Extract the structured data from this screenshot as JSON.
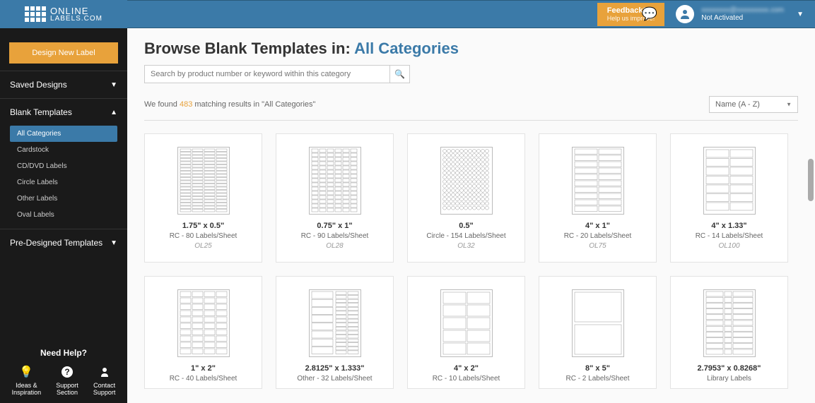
{
  "header": {
    "logo_line1": "ONLINE",
    "logo_line2": "LABELS.COM",
    "feedback_title": "Feedback?",
    "feedback_sub": "Help us improve!",
    "user_email": "xxxxxxxx@xxxxxxxxx.com",
    "user_status": "Not Activated"
  },
  "sidebar": {
    "design_btn": "Design New Label",
    "sections": [
      {
        "title": "Saved Designs",
        "expanded": false
      },
      {
        "title": "Blank Templates",
        "expanded": true,
        "items": [
          {
            "label": "All Categories",
            "active": true
          },
          {
            "label": "Cardstock"
          },
          {
            "label": "CD/DVD Labels"
          },
          {
            "label": "Circle Labels"
          },
          {
            "label": "Other Labels"
          },
          {
            "label": "Oval Labels"
          }
        ]
      },
      {
        "title": "Pre-Designed Templates",
        "expanded": false
      }
    ],
    "help_title": "Need Help?",
    "help_items": [
      {
        "label1": "Ideas &",
        "label2": "Inspiration"
      },
      {
        "label1": "Support",
        "label2": "Section"
      },
      {
        "label1": "Contact",
        "label2": "Support"
      }
    ]
  },
  "main": {
    "title_prefix": "Browse Blank Templates in: ",
    "title_category": "All Categories",
    "search_placeholder": "Search by product number or keyword within this category",
    "results_prefix": "We found ",
    "results_count": "483",
    "results_suffix": " matching results in \"All Categories\"",
    "sort_value": "Name (A - Z)",
    "templates": [
      {
        "title": "1.75\" x 0.5\"",
        "sub": "RC - 80 Labels/Sheet",
        "code": "OL25",
        "thumb": "grid-80-narrow"
      },
      {
        "title": "0.75\" x 1\"",
        "sub": "RC - 90 Labels/Sheet",
        "code": "OL28",
        "thumb": "grid-90"
      },
      {
        "title": "0.5\"",
        "sub": "Circle - 154 Labels/Sheet",
        "code": "OL32",
        "thumb": "circles-154"
      },
      {
        "title": "4\" x 1\"",
        "sub": "RC - 20 Labels/Sheet",
        "code": "OL75",
        "thumb": "grid-20"
      },
      {
        "title": "4\" x 1.33\"",
        "sub": "RC - 14 Labels/Sheet",
        "code": "OL100",
        "thumb": "grid-14"
      },
      {
        "title": "1\" x 2\"",
        "sub": "RC - 40 Labels/Sheet",
        "code": "",
        "thumb": "grid-40"
      },
      {
        "title": "2.8125\" x 1.333\"",
        "sub": "Other - 32 Labels/Sheet",
        "code": "",
        "thumb": "grid-32-mixed"
      },
      {
        "title": "4\" x 2\"",
        "sub": "RC - 10 Labels/Sheet",
        "code": "",
        "thumb": "grid-10"
      },
      {
        "title": "8\" x 5\"",
        "sub": "RC - 2 Labels/Sheet",
        "code": "",
        "thumb": "grid-2"
      },
      {
        "title": "2.7953\" x 0.8268\"",
        "sub": "Library Labels",
        "code": "",
        "thumb": "library"
      }
    ]
  }
}
